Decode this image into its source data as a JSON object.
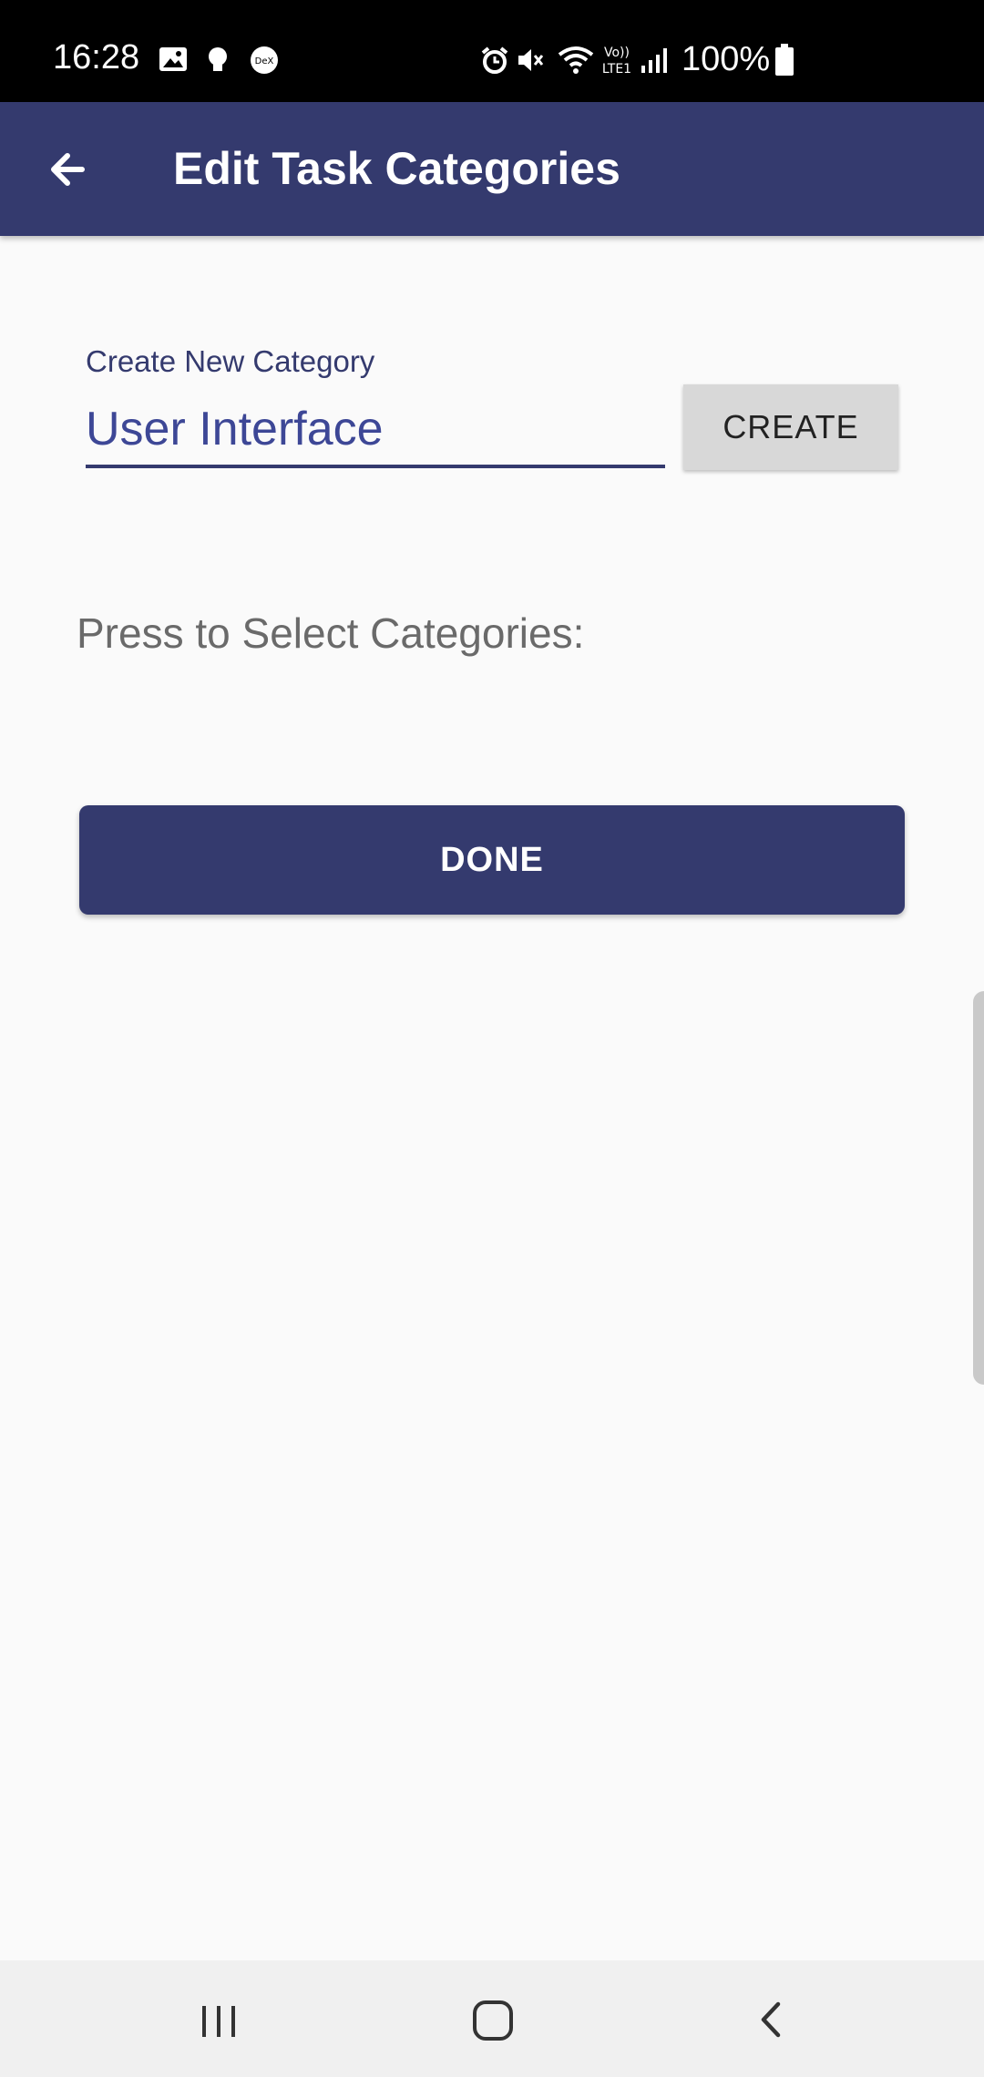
{
  "status_bar": {
    "time": "16:28",
    "battery_text": "100%",
    "icons": [
      "gallery-icon",
      "bulb-icon",
      "dex-icon",
      "alarm-icon",
      "mute-icon",
      "wifi-icon",
      "volte-icon",
      "signal-icon",
      "battery-icon"
    ]
  },
  "app_bar": {
    "title": "Edit Task Categories",
    "back_icon": "back-arrow-icon"
  },
  "new_category": {
    "label": "Create New Category",
    "value": "User Interface",
    "button_label": "CREATE"
  },
  "select_label": "Press to Select Categories:",
  "done_label": "DONE",
  "nav_bar": {
    "icons": [
      "recent-apps-icon",
      "home-icon",
      "back-icon"
    ]
  },
  "colors": {
    "primary": "#343a6e",
    "input_text": "#3d4796",
    "background": "#fafafa"
  }
}
